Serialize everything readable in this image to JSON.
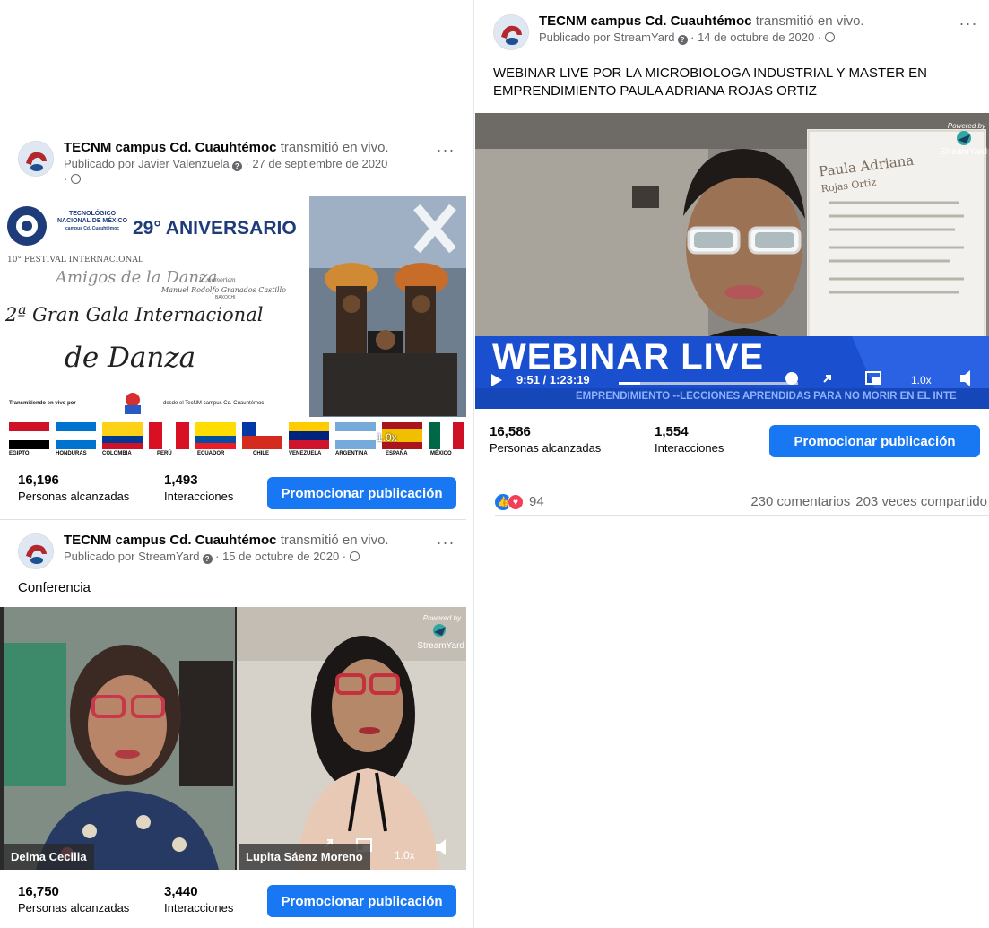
{
  "colors": {
    "facebook_blue": "#1877f2",
    "secondary_text": "#65676b",
    "divider": "#dfe1e5"
  },
  "posts": [
    {
      "page_name": "TECNM campus Cd. Cuauhtémoc",
      "live_verb": "transmitió en vivo.",
      "published_by": "Publicado por StreamYard",
      "date": "14 de octubre de 2020",
      "caption": "WEBINAR LIVE POR LA MICROBIOLOGA INDUSTRIAL Y MASTER EN EMPRENDIMIENTO PAULA ADRIANA ROJAS ORTIZ",
      "video": {
        "banner": "WEBINAR LIVE",
        "time": "9:51 / 1:23:19",
        "speed": "1.0x",
        "ticker": "EMPRENDIMIENTO --LECCIONES APRENDIDAS PARA NO MORIR EN EL INTE",
        "poster_name_line1": "Paula Adriana",
        "poster_name_line2": "Rojas Ortiz",
        "powered_by": "Powered by",
        "streamyard": "StreamYard",
        "progress": 0.118
      },
      "reach_value": "16,586",
      "reach_label": "Personas alcanzadas",
      "interactions_value": "1,554",
      "interactions_label": "Interacciones",
      "promote_label": "Promocionar publicación",
      "reaction_count": "94",
      "comments": "230 comentarios",
      "shares": "203 veces compartido"
    },
    {
      "page_name": "TECNM campus Cd. Cuauhtémoc",
      "live_verb": "transmitió en vivo.",
      "published_by": "Publicado por Javier Valenzuela",
      "date": "27 de septiembre de 2020",
      "flyer": {
        "inst_line1": "TECNOLÓGICO",
        "inst_line2": "NACIONAL DE MÉXICO",
        "inst_line3": "campus Cd. Cuauhtémoc",
        "anniversary": "29° ANIVERSARIO",
        "festival": "10° FESTIVAL INTERNACIONAL",
        "amigos": "Amigos de la Danza",
        "en_memoria": "In memoriam",
        "memoria_name": "Manuel Rodolfo Granados Castillo",
        "memoria_sub": "BAXOCHI",
        "gala_prefix": "2ª",
        "gala_line1": "Gran Gala Internacional",
        "gala_line2": "de Danza",
        "transmitiendo": "Transmitiendo en vivo por",
        "desde": "desde el TecNM campus Cd. Cuauhtémoc",
        "speed": "1.0x",
        "countries": [
          "EGIPTO",
          "HONDURAS",
          "COLOMBIA",
          "PERÚ",
          "ECUADOR",
          "CHILE",
          "VENEZUELA",
          "ARGENTINA",
          "ESPAÑA",
          "MÉXICO"
        ]
      },
      "reach_value": "16,196",
      "reach_label": "Personas alcanzadas",
      "interactions_value": "1,493",
      "interactions_label": "Interacciones",
      "promote_label": "Promocionar publicación"
    },
    {
      "page_name": "TECNM campus Cd. Cuauhtémoc",
      "live_verb": "transmitió en vivo.",
      "published_by": "Publicado por StreamYard",
      "date": "15 de octubre de 2020",
      "caption": "Conferencia",
      "video": {
        "left_name": "Delma Cecilia",
        "right_name": "Lupita Sáenz Moreno",
        "speed": "1.0x",
        "powered_by": "Powered by",
        "streamyard": "StreamYard"
      },
      "reach_value": "16,750",
      "reach_label": "Personas alcanzadas",
      "interactions_value": "3,440",
      "interactions_label": "Interacciones",
      "promote_label": "Promocionar publicación"
    }
  ]
}
